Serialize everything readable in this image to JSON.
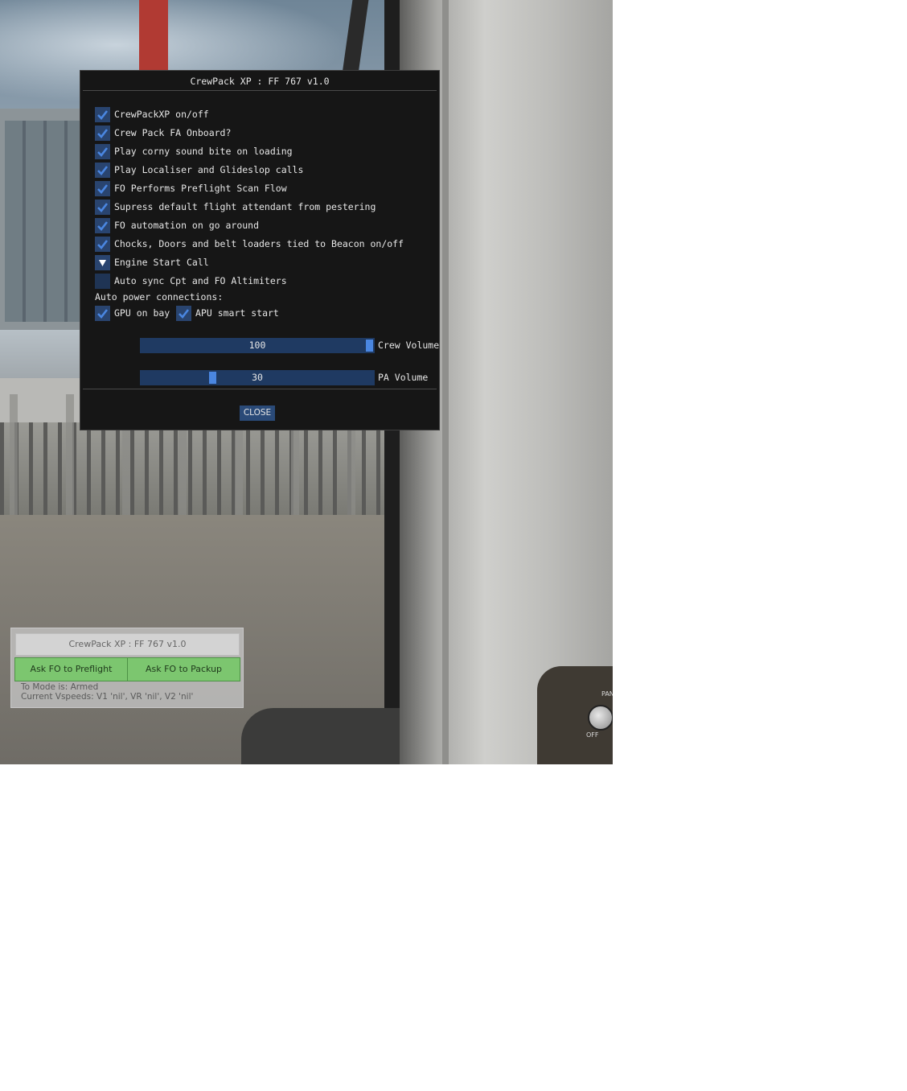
{
  "dialog": {
    "title": "CrewPack XP : FF 767 v1.0",
    "options": [
      {
        "label": "CrewPackXP on/off",
        "state": "checked"
      },
      {
        "label": "Crew Pack FA Onboard?",
        "state": "checked"
      },
      {
        "label": "Play corny sound bite on loading",
        "state": "checked"
      },
      {
        "label": "Play Localiser and Glideslop calls",
        "state": "checked"
      },
      {
        "label": "FO Performs Preflight Scan Flow",
        "state": "checked"
      },
      {
        "label": "Supress default flight attendant from pestering",
        "state": "checked"
      },
      {
        "label": "FO automation on go around",
        "state": "checked"
      },
      {
        "label": "Chocks, Doors and belt loaders tied to Beacon on/off",
        "state": "checked"
      },
      {
        "label": "Engine Start Call",
        "state": "collapsed"
      },
      {
        "label": "Auto sync Cpt and FO Altimiters",
        "state": "unchecked"
      }
    ],
    "auto_power_label": "Auto power connections:",
    "gpu_label": "GPU on bay",
    "apu_label": "APU smart start",
    "crew_volume": {
      "value": "100",
      "label": "Crew Volume",
      "level": 100
    },
    "pa_volume": {
      "value": "30",
      "label": "PA Volume",
      "level": 30
    },
    "close_label": "CLOSE"
  },
  "widget": {
    "title": "CrewPack XP : FF 767 v1.0",
    "preflight_button": "Ask FO to Preflight",
    "packup_button": "Ask FO to Packup",
    "to_mode": "To Mode is: Armed",
    "vspeeds": "Current Vspeeds: V1 'nil', VR 'nil', V2 'nil'"
  },
  "scene": {
    "panel_label_pan": "PAN",
    "panel_label_off": "OFF"
  },
  "colors": {
    "checkbox_bg": "#29446f",
    "check_mark": "#4a86e0",
    "slider_bg": "#1f3a62",
    "button_green": "#7cc66f"
  }
}
